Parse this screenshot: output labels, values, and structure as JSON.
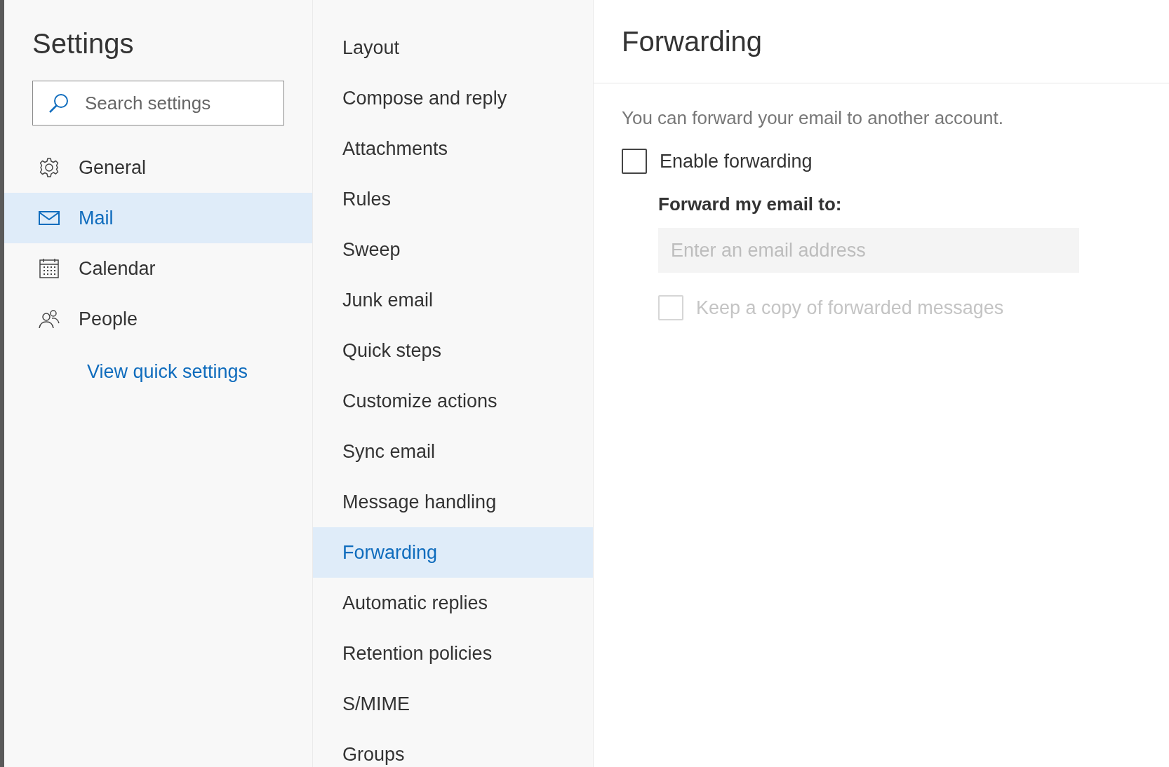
{
  "settings": {
    "title": "Settings",
    "search": {
      "placeholder": "Search settings"
    },
    "nav": [
      {
        "label": "General",
        "kind": "gear",
        "selected": false
      },
      {
        "label": "Mail",
        "kind": "mail",
        "selected": true
      },
      {
        "label": "Calendar",
        "kind": "calendar",
        "selected": false
      },
      {
        "label": "People",
        "kind": "people",
        "selected": false
      }
    ],
    "quick_link": "View quick settings"
  },
  "categories": [
    {
      "label": "Layout",
      "selected": false
    },
    {
      "label": "Compose and reply",
      "selected": false
    },
    {
      "label": "Attachments",
      "selected": false
    },
    {
      "label": "Rules",
      "selected": false
    },
    {
      "label": "Sweep",
      "selected": false
    },
    {
      "label": "Junk email",
      "selected": false
    },
    {
      "label": "Quick steps",
      "selected": false
    },
    {
      "label": "Customize actions",
      "selected": false
    },
    {
      "label": "Sync email",
      "selected": false
    },
    {
      "label": "Message handling",
      "selected": false
    },
    {
      "label": "Forwarding",
      "selected": true
    },
    {
      "label": "Automatic replies",
      "selected": false
    },
    {
      "label": "Retention policies",
      "selected": false
    },
    {
      "label": "S/MIME",
      "selected": false
    },
    {
      "label": "Groups",
      "selected": false
    }
  ],
  "panel": {
    "title": "Forwarding",
    "description": "You can forward your email to another account.",
    "enable": {
      "label": "Enable forwarding",
      "checked": false,
      "disabled": false
    },
    "forward_label": "Forward my email to:",
    "address": {
      "placeholder": "Enter an email address",
      "disabled": true
    },
    "keep_copy": {
      "label": "Keep a copy of forwarded messages",
      "checked": false,
      "disabled": true
    }
  }
}
